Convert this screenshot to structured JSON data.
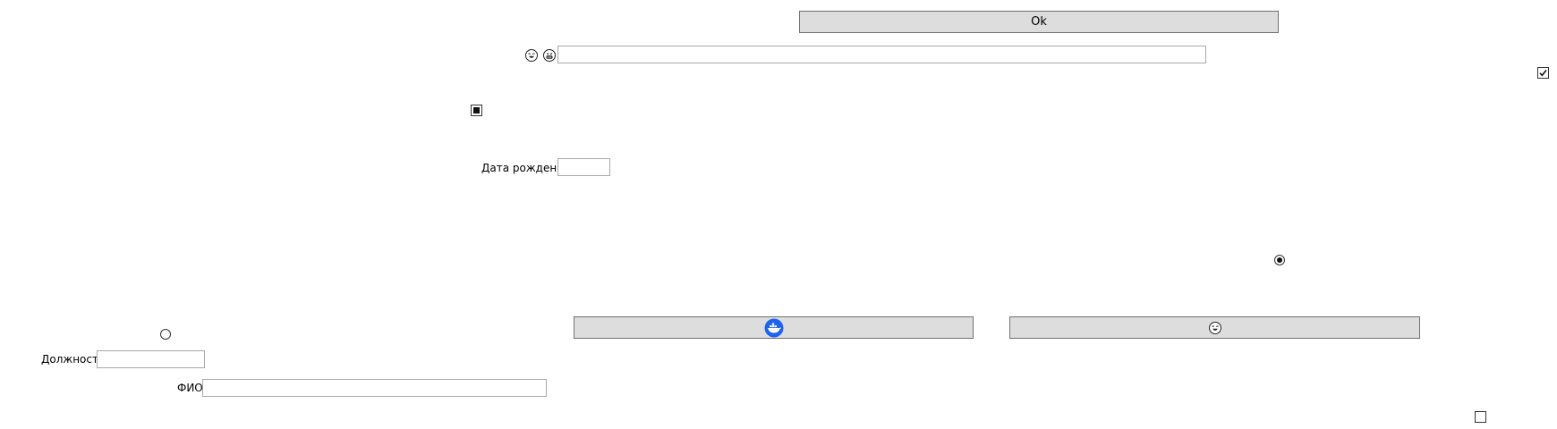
{
  "buttons": {
    "ok_label": "Ok"
  },
  "labels": {
    "birth_date": "Дата рождения",
    "position": "Должность",
    "full_name": "ФИО"
  },
  "fields": {
    "top_text_value": "",
    "birth_date_value": "",
    "position_value": "",
    "full_name_value": ""
  },
  "controls": {
    "checkbox_top_right_checked": true,
    "checkbox_left_state": "indeterminate",
    "checkbox_bottom_right_checked": false,
    "radio_right_selected": true,
    "radio_left_selected": false
  },
  "icons": {
    "emoji_left": "laughing-face-icon",
    "emoji_right": "grinning-face-icon",
    "button_left_icon": "docker-whale-icon",
    "button_right_icon": "laughing-face-icon"
  },
  "colors": {
    "button_bg": "#dddddd",
    "docker_blue": "#1d63ed"
  }
}
